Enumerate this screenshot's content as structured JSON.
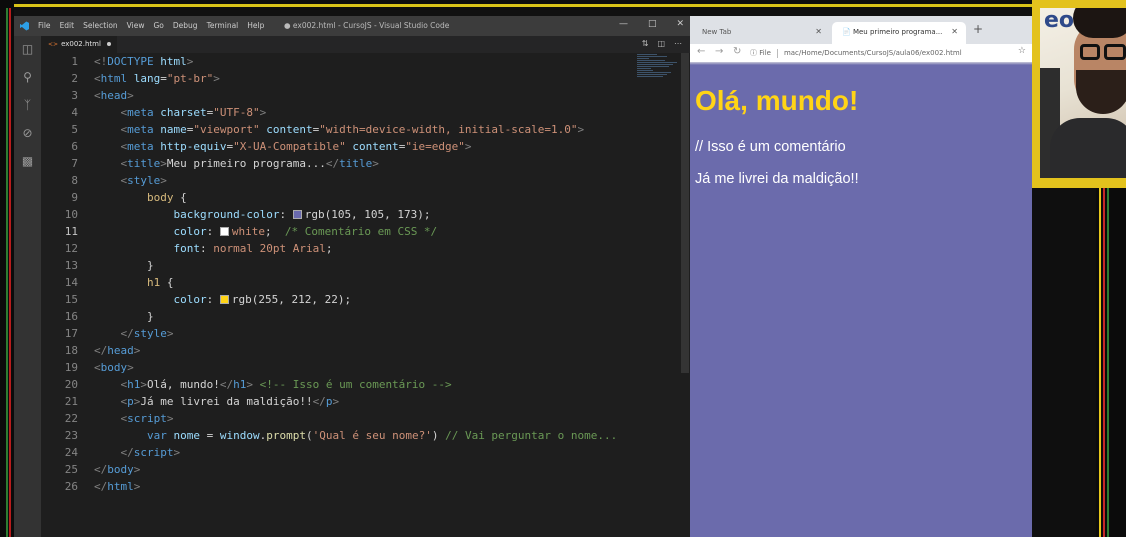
{
  "vscode": {
    "menu": [
      "File",
      "Edit",
      "Selection",
      "View",
      "Go",
      "Debug",
      "Terminal",
      "Help"
    ],
    "window_title": "● ex002.html - CursoJS - Visual Studio Code",
    "tab": {
      "label": "ex002.html"
    },
    "active_line": 11,
    "line_numbers": [
      "1",
      "2",
      "3",
      "4",
      "5",
      "6",
      "7",
      "8",
      "9",
      "10",
      "11",
      "12",
      "13",
      "14",
      "15",
      "16",
      "17",
      "18",
      "19",
      "20",
      "21",
      "22",
      "23",
      "24",
      "25",
      "26"
    ],
    "lines": {
      "l1": [
        "<!",
        "DOCTYPE",
        " html",
        ">"
      ],
      "l2": [
        "<",
        "html",
        " lang",
        "=",
        "\"pt-br\"",
        ">"
      ],
      "l3": [
        "<",
        "head",
        ">"
      ],
      "l4": [
        "    <",
        "meta",
        " charset",
        "=",
        "\"UTF-8\"",
        ">"
      ],
      "l5": [
        "    <",
        "meta",
        " name",
        "=",
        "\"viewport\"",
        " content",
        "=",
        "\"width=device-width, initial-scale=1.0\"",
        ">"
      ],
      "l6": [
        "    <",
        "meta",
        " http-equiv",
        "=",
        "\"X-UA-Compatible\"",
        " content",
        "=",
        "\"ie=edge\"",
        ">"
      ],
      "l7": [
        "    <",
        "title",
        ">",
        "Meu primeiro programa...",
        "</",
        "title",
        ">"
      ],
      "l8": [
        "    <",
        "style",
        ">"
      ],
      "l9": [
        "        ",
        "body",
        " {"
      ],
      "l10": [
        "            ",
        "background-color",
        ": ",
        "rgb(105, 105, 173);"
      ],
      "l11": [
        "            ",
        "color",
        ": ",
        "white",
        ";  ",
        "/* Comentário em CSS */"
      ],
      "l12": [
        "            ",
        "font",
        ": ",
        "normal 20pt Arial",
        ";"
      ],
      "l13": [
        "        }"
      ],
      "l14": [
        "        ",
        "h1",
        " {"
      ],
      "l15": [
        "            ",
        "color",
        ": ",
        "rgb(255, 212, 22);"
      ],
      "l16": [
        "        }"
      ],
      "l17": [
        "    </",
        "style",
        ">"
      ],
      "l18": [
        "</",
        "head",
        ">"
      ],
      "l19": [
        "<",
        "body",
        ">"
      ],
      "l20": [
        "    <",
        "h1",
        ">",
        "Olá, mundo!",
        "</",
        "h1",
        "> ",
        "<!-- Isso é um comentário -->"
      ],
      "l21": [
        "    <",
        "p",
        ">",
        "Já me livrei da maldição!!",
        "</",
        "p",
        ">"
      ],
      "l22": [
        "    <",
        "script",
        ">"
      ],
      "l23": [
        "        ",
        "var",
        " nome",
        " = ",
        "window",
        ".",
        "prompt",
        "(",
        "'Qual é seu nome?'",
        ") ",
        "// Vai perguntar o nome..."
      ],
      "l24": [
        "    </",
        "script",
        ">"
      ],
      "l25": [
        "</",
        "body",
        ">"
      ],
      "l26": [
        "</",
        "html",
        ">"
      ]
    },
    "swatch_colors": {
      "bg": "#6969ad",
      "white": "#ffffff",
      "h1": "#ffd416"
    }
  },
  "browser": {
    "tabs": [
      {
        "label": "New Tab",
        "active": false
      },
      {
        "label": "Meu primeiro programa...",
        "active": true
      }
    ],
    "address": {
      "scheme_label": "File",
      "path": "mac/Home/Documents/CursoJS/aula06/ex002.html"
    },
    "page": {
      "h1": "Olá, mundo!",
      "p1": "// Isso é um comentário",
      "p2": "Já me livrei da maldição!!"
    },
    "colors": {
      "background": "#6969ad",
      "h1": "#ffd416",
      "text": "#ffffff"
    }
  },
  "webcam": {
    "logo_text": "eo"
  }
}
